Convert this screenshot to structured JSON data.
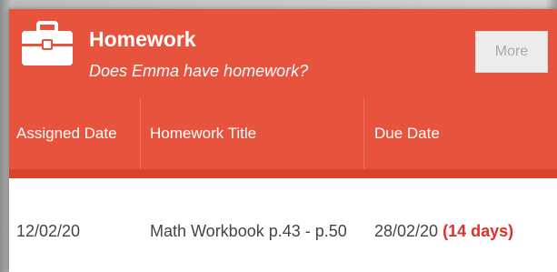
{
  "widget": {
    "title": "Homework",
    "subtitle": "Does Emma have homework?",
    "more_label": "More",
    "icon": "briefcase-icon"
  },
  "table": {
    "columns": [
      "Assigned Date",
      "Homework Title",
      "Due Date"
    ],
    "rows": [
      {
        "assigned": "12/02/20",
        "title": "Math Workbook p.43 - p.50",
        "due": "28/02/20",
        "days": "(14 days)"
      }
    ]
  },
  "colors": {
    "header": "#e8533d",
    "accent_red": "#e0302a",
    "button_bg": "#ececec",
    "button_text": "#a9a9a9"
  }
}
